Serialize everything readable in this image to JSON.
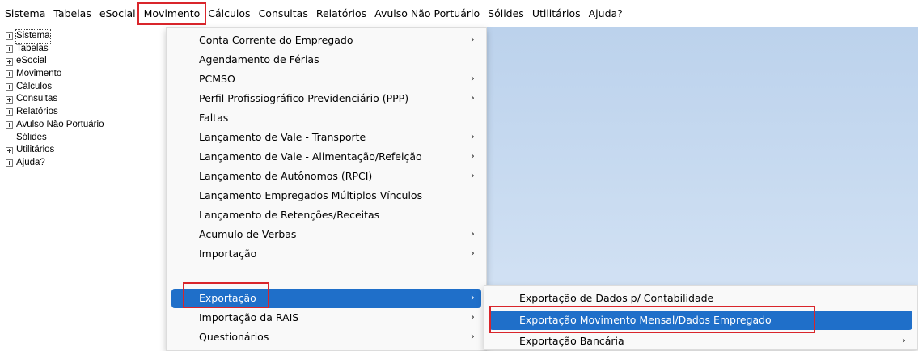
{
  "menubar": {
    "items": [
      "Sistema",
      "Tabelas",
      "eSocial",
      "Movimento",
      "Cálculos",
      "Consultas",
      "Relatórios",
      "Avulso Não Portuário",
      "Sólides",
      "Utilitários",
      "Ajuda?"
    ]
  },
  "tree": {
    "items": [
      {
        "label": "Sistema",
        "expandable": true
      },
      {
        "label": "Tabelas",
        "expandable": true
      },
      {
        "label": "eSocial",
        "expandable": true
      },
      {
        "label": "Movimento",
        "expandable": true
      },
      {
        "label": "Cálculos",
        "expandable": true
      },
      {
        "label": "Consultas",
        "expandable": true
      },
      {
        "label": "Relatórios",
        "expandable": true
      },
      {
        "label": "Avulso Não Portuário",
        "expandable": true
      },
      {
        "label": "Sólides",
        "expandable": false
      },
      {
        "label": "Utilitários",
        "expandable": true
      },
      {
        "label": "Ajuda?",
        "expandable": true
      }
    ]
  },
  "movimento_menu": {
    "items": [
      {
        "label": "Conta Corrente do Empregado",
        "submenu": true
      },
      {
        "label": "Agendamento de Férias",
        "submenu": false
      },
      {
        "label": "PCMSO",
        "submenu": true
      },
      {
        "label": "Perfil Profissiográfico Previdenciário (PPP)",
        "submenu": true
      },
      {
        "label": "Faltas",
        "submenu": false
      },
      {
        "label": "Lançamento de Vale - Transporte",
        "submenu": true
      },
      {
        "label": "Lançamento de Vale - Alimentação/Refeição",
        "submenu": true
      },
      {
        "label": "Lançamento de Autônomos (RPCI)",
        "submenu": true
      },
      {
        "label": "Lançamento Empregados Múltiplos Vínculos",
        "submenu": false
      },
      {
        "label": "Lançamento de Retenções/Receitas",
        "submenu": false
      },
      {
        "label": "Acumulo de Verbas",
        "submenu": true
      },
      {
        "label": "Importação",
        "submenu": true
      },
      {
        "label": "Exportação",
        "submenu": true,
        "highlighted": true
      },
      {
        "label": "Importação da RAIS",
        "submenu": true
      },
      {
        "label": "Questionários",
        "submenu": true
      }
    ]
  },
  "exportacao_menu": {
    "items": [
      {
        "label": "Exportação de Dados p/ Contabilidade",
        "submenu": false
      },
      {
        "label": "Exportação Movimento Mensal/Dados Empregado",
        "submenu": false,
        "highlighted": true
      },
      {
        "label": "Exportação Bancária",
        "submenu": true
      }
    ]
  },
  "symbols": {
    "submenu_arrow": "›"
  },
  "colors": {
    "highlight": "#1f6fc9",
    "annotation": "#d9252b"
  }
}
